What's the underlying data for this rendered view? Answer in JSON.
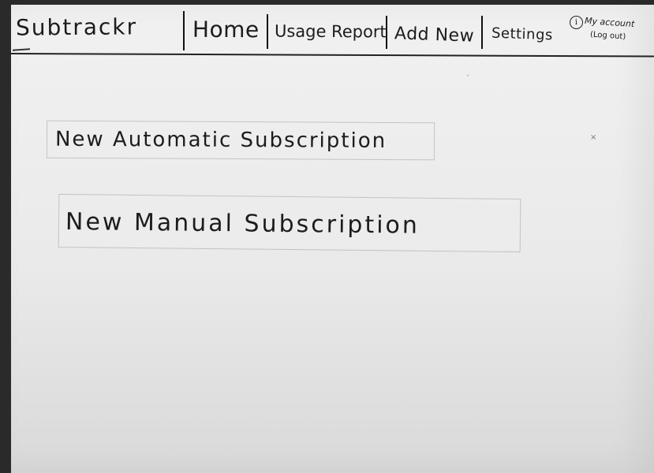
{
  "app": {
    "logo": "Subtrackr"
  },
  "nav": {
    "items": [
      {
        "label": "Home"
      },
      {
        "label": "Usage Report"
      },
      {
        "label": "Add New"
      },
      {
        "label": "Settings"
      }
    ],
    "account": {
      "icon": "user-info-icon",
      "icon_glyph": "i",
      "label": "My account",
      "logout": "(Log out)"
    }
  },
  "main": {
    "options": [
      {
        "label": "New Automatic Subscription"
      },
      {
        "label": "New Manual Subscription"
      }
    ]
  },
  "colors": {
    "paper": "#ececec",
    "ink": "#1c1c1c"
  }
}
